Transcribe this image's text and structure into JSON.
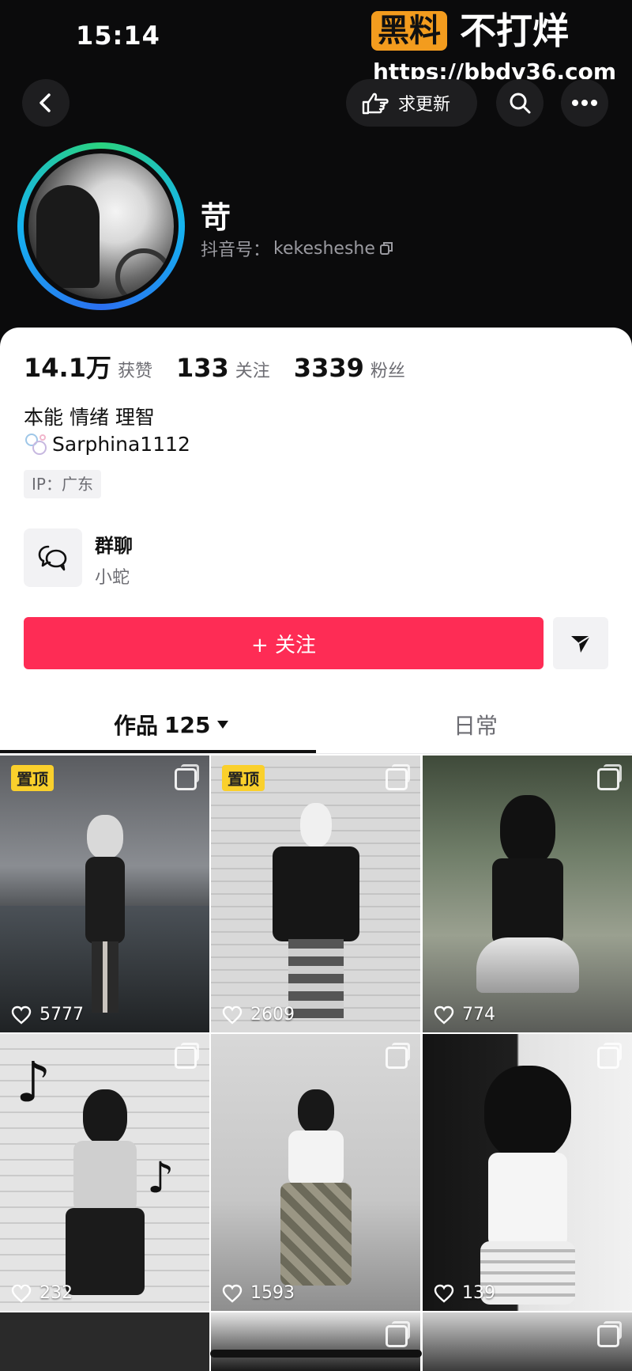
{
  "status_bar": {
    "time": "15:14"
  },
  "watermark": {
    "badge": "黑料",
    "text": "不打烊",
    "url": "https://bbdy36.com"
  },
  "top_nav": {
    "request_update_label": "求更新"
  },
  "profile": {
    "name": "苛",
    "douyin_id_label": "抖音号：",
    "douyin_id": "kekesheshe"
  },
  "stats": [
    {
      "value": "14.1万",
      "label": "获赞"
    },
    {
      "value": "133",
      "label": "关注"
    },
    {
      "value": "3339",
      "label": "粉丝"
    }
  ],
  "bio": "本能 情绪 理智",
  "linked_account": "Sarphina1112",
  "ip_location": "IP：广东",
  "group_chat": {
    "title": "群聊",
    "subtitle": "小蛇"
  },
  "follow_button": {
    "label": "+ 关注"
  },
  "tabs": {
    "works_label": "作品",
    "works_count": "125",
    "daily_label": "日常"
  },
  "grid": [
    {
      "pinned": true,
      "pin_label": "置顶",
      "likes": "5777"
    },
    {
      "pinned": true,
      "pin_label": "置顶",
      "likes": "2609"
    },
    {
      "pinned": false,
      "pin_label": "",
      "likes": "774"
    },
    {
      "pinned": false,
      "pin_label": "",
      "likes": "232"
    },
    {
      "pinned": false,
      "pin_label": "",
      "likes": "1593"
    },
    {
      "pinned": false,
      "pin_label": "",
      "likes": "139"
    }
  ],
  "colors": {
    "follow": "#fe2c55",
    "pin": "#fad02c",
    "header_bg": "#0b0b0c"
  }
}
